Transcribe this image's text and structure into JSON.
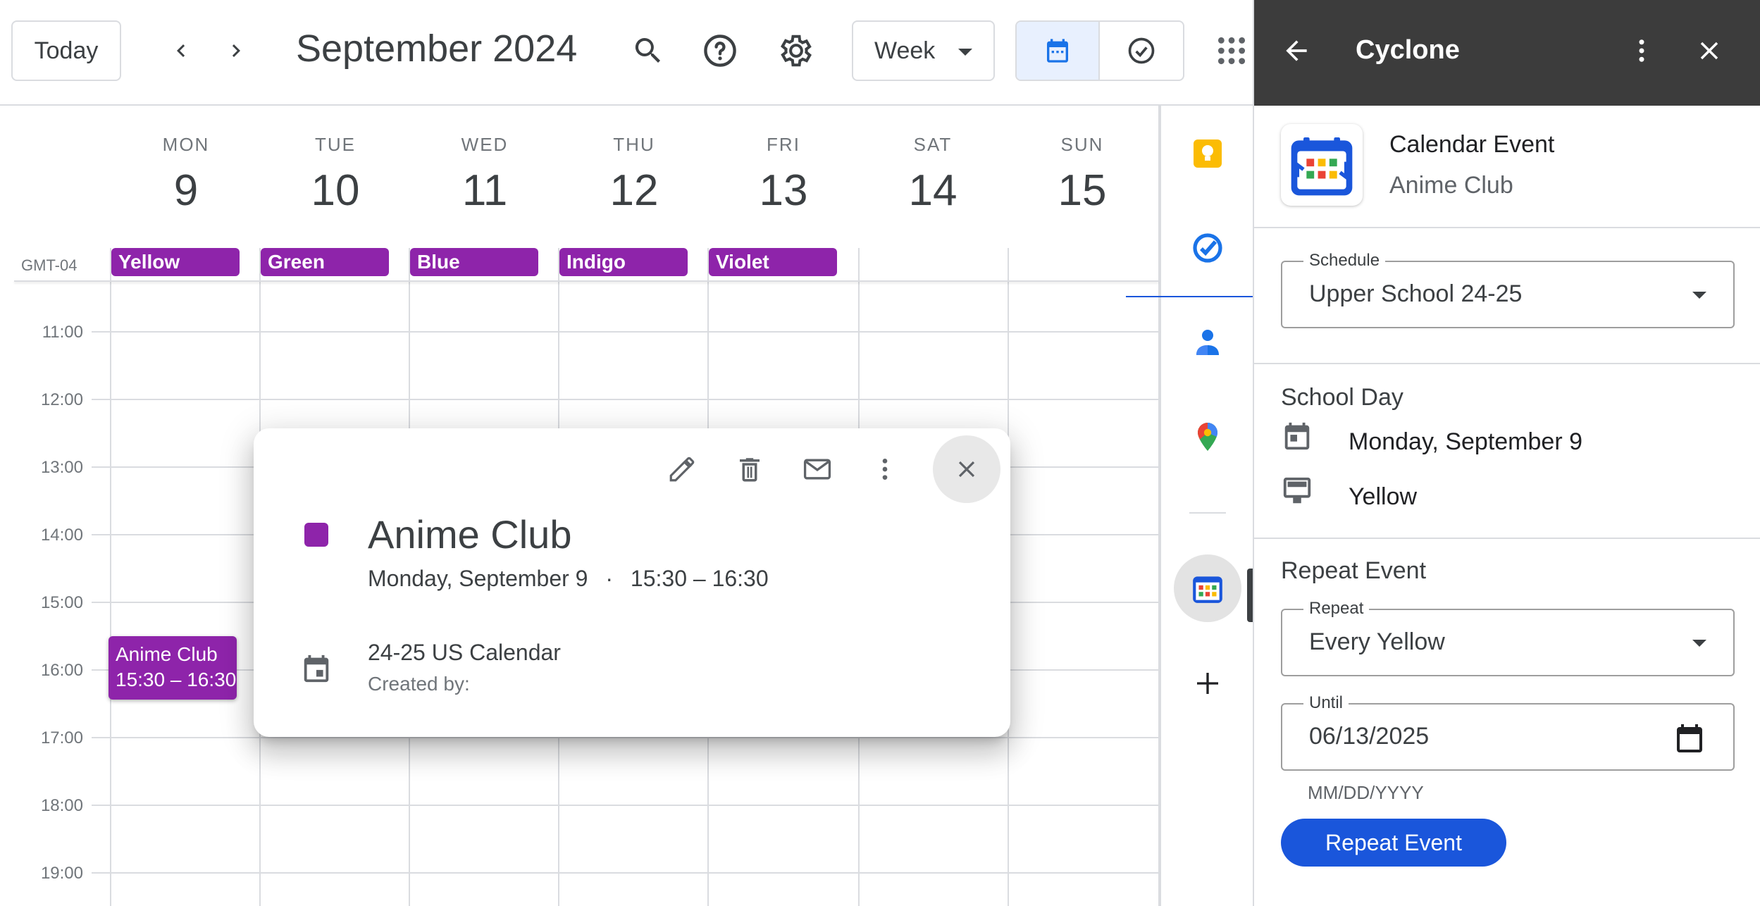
{
  "header": {
    "today_label": "Today",
    "month_title": "September 2024",
    "view_select": "Week"
  },
  "calendar": {
    "timezone": "GMT-04",
    "days": [
      {
        "dow": "MON",
        "num": "9"
      },
      {
        "dow": "TUE",
        "num": "10"
      },
      {
        "dow": "WED",
        "num": "11"
      },
      {
        "dow": "THU",
        "num": "12"
      },
      {
        "dow": "FRI",
        "num": "13"
      },
      {
        "dow": "SAT",
        "num": "14"
      },
      {
        "dow": "SUN",
        "num": "15"
      }
    ],
    "allday_events": [
      "Yellow",
      "Green",
      "Blue",
      "Indigo",
      "Violet"
    ],
    "hours": [
      "11:00",
      "12:00",
      "13:00",
      "14:00",
      "15:00",
      "16:00",
      "17:00",
      "18:00",
      "19:00"
    ],
    "event": {
      "title": "Anime Club",
      "time": "15:30 – 16:30"
    }
  },
  "popup": {
    "title": "Anime Club",
    "date": "Monday, September 9",
    "separator": "·",
    "time": "15:30 – 16:30",
    "calendar_name": "24-25 US Calendar",
    "created_by": "Created by:"
  },
  "panel": {
    "title": "Cyclone",
    "card_type": "Calendar Event",
    "card_name": "Anime Club",
    "schedule_label": "Schedule",
    "schedule_value": "Upper School 24-25",
    "school_day_heading": "School Day",
    "school_day_date": "Monday, September 9",
    "school_day_color": "Yellow",
    "repeat_heading": "Repeat Event",
    "repeat_label": "Repeat",
    "repeat_value": "Every Yellow",
    "until_label": "Until",
    "until_value": "06/13/2025",
    "date_hint": "MM/DD/YYYY",
    "repeat_button": "Repeat Event"
  },
  "colors": {
    "event_purple": "#8e24aa",
    "accent_blue": "#1a56db",
    "panel_header": "#3c3c3c"
  }
}
